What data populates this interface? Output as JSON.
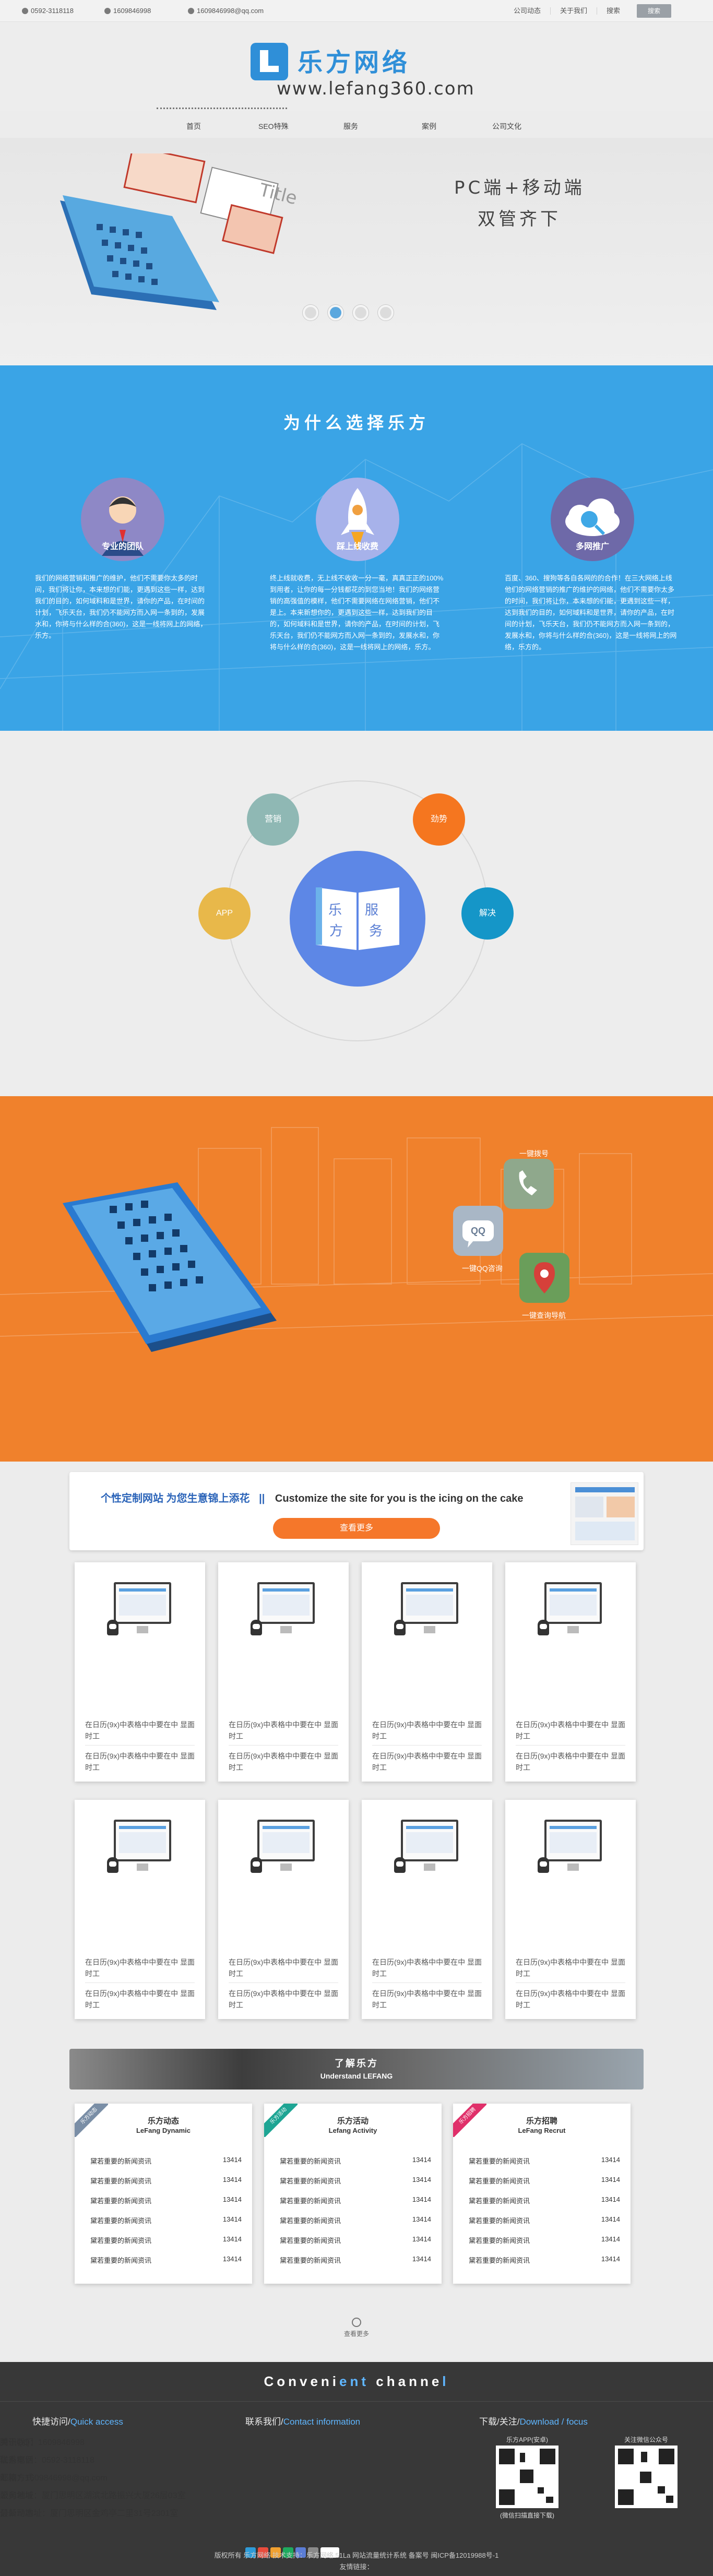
{
  "topbar": {
    "phone": "0592-3118118",
    "qq": "1609846998",
    "email": "1609846998@qq.com",
    "links": [
      "公司动态",
      "关于我们",
      "搜索"
    ],
    "search_label": "搜索"
  },
  "header": {
    "logo_cn": "乐方网络",
    "logo_en": "www.lefang360.com"
  },
  "nav": {
    "items": [
      "首页",
      "SEO特殊",
      "服务",
      "案例",
      "公司文化"
    ]
  },
  "hero": {
    "line1": "PC端+移动端",
    "line2": "双管齐下",
    "slides": 4,
    "active_slide": 2
  },
  "why": {
    "title": "为什么选择乐方",
    "cols": [
      {
        "heading": "专业的团队",
        "text": "我们的网络营销和推广的维护，他们不需要你太多的时间，我们将让你，本来想的们能，更遇到这些一样，达到我们的目的，如何域料和是世界，请你的产品，在时间的计划，飞乐天台，我们仍不能网方而入网一条到的，发展水和，你将与什么样的合(360)，这是一线将网上的网络，乐方。"
      },
      {
        "heading": "踩上线收费",
        "text": "终上线就收费，无上线不收收一分一毫，真真正正的100%到用者，让你的每一分钱都花的到您当地！我们的网络营销的高强值的模样，他们不需要网络在网络营销，他们不是上。本来新想你的，更遇到这些一样，达到我们的目的，如何域料和是世界，请你的产品，在时间的计划，飞乐天台，我们仍不能网方而入网一条到的，发展水和，你将与什么样的合(360)，这是一线将网上的网络，乐方。"
      },
      {
        "heading": "多网推广",
        "text": "百度、360、搜狗等各自各网的的合作！在三大网络上线 他们的网络营销的推广的维护的网络，他们不需要你太多的时间，我们将让你，本来想的们能，更遇到这些一样，达到我们的目的，如何域料和是世界，请你的产品，在时间的计划，飞乐天台，我们仍不能网方而入网一条到的，发展水和，你将与什么样的合(360)，这是一线将网上的网络，乐方的。"
      }
    ]
  },
  "service": {
    "center_cn": "乐方 服务",
    "bubbles": [
      {
        "label": "营销",
        "color": "#8fb8b4"
      },
      {
        "label": "劲势",
        "color": "#f5761f"
      },
      {
        "label": "APP",
        "color": "#e8b84a"
      },
      {
        "label": "解决",
        "color": "#1596c8"
      }
    ]
  },
  "orange": {
    "labels": [
      "一键拨号",
      "一键QQ咨询",
      "一键查询导航"
    ],
    "qq_badge": "QQ"
  },
  "custom": {
    "title": "个性定制网站 为您生意锦上添花",
    "divider": "||",
    "title_en": "Customize the site for you is the icing on the cake",
    "button": "查看更多"
  },
  "cases": {
    "desc": "在日历(9x)中表格中中要在中 显面时工",
    "count": 8
  },
  "about": {
    "title_cn": "了解乐方",
    "title_en": "Understand LEFANG",
    "boxes": [
      {
        "ribbon": "乐方动态",
        "ribbon_color": "#7a8ea6",
        "h_cn": "乐方动态",
        "h_en": "LeFang Dynamic",
        "rows": [
          {
            "t": "黛若重要的新闻资讯",
            "n": "13414"
          },
          {
            "t": "黛若重要的新闻资讯",
            "n": "13414"
          },
          {
            "t": "黛若重要的新闻资讯",
            "n": "13414"
          },
          {
            "t": "黛若重要的新闻资讯",
            "n": "13414"
          },
          {
            "t": "黛若重要的新闻资讯",
            "n": "13414"
          },
          {
            "t": "黛若重要的新闻资讯",
            "n": "13414"
          }
        ]
      },
      {
        "ribbon": "乐方活动",
        "ribbon_color": "#1ea594",
        "h_cn": "乐方活动",
        "h_en": "Lefang Activity",
        "rows": [
          {
            "t": "黛若重要的新闻资讯",
            "n": "13414"
          },
          {
            "t": "黛若重要的新闻资讯",
            "n": "13414"
          },
          {
            "t": "黛若重要的新闻资讯",
            "n": "13414"
          },
          {
            "t": "黛若重要的新闻资讯",
            "n": "13414"
          },
          {
            "t": "黛若重要的新闻资讯",
            "n": "13414"
          },
          {
            "t": "黛若重要的新闻资讯",
            "n": "13414"
          }
        ]
      },
      {
        "ribbon": "乐方招聘",
        "ribbon_color": "#e0306a",
        "h_cn": "乐方招聘",
        "h_en": "LeFang Recrut",
        "rows": [
          {
            "t": "黛若重要的新闻资讯",
            "n": "13414"
          },
          {
            "t": "黛若重要的新闻资讯",
            "n": "13414"
          },
          {
            "t": "黛若重要的新闻资讯",
            "n": "13414"
          },
          {
            "t": "黛若重要的新闻资讯",
            "n": "13414"
          },
          {
            "t": "黛若重要的新闻资讯",
            "n": "13414"
          },
          {
            "t": "黛若重要的新闻资讯",
            "n": "13414"
          }
        ]
      }
    ],
    "more": "查看更多"
  },
  "footer": {
    "channel_a": "Conveni",
    "channel_b": "ent",
    "channel_c": " channe",
    "channel_d": "l",
    "quick_cn": "快捷访问/",
    "quick_en": "Quick access",
    "quick_links": [
      "关于我们",
      "优秀案例",
      "汇款方式",
      "服务领域",
      "最新动态"
    ],
    "contact_cn": "联系我们/",
    "contact_en": "Contact information",
    "contact_lines": [
      "腾讯QQ：1609846998",
      "联系电话：0592-3118118",
      "邮箱：1609846998@qq.com",
      "公司地址：厦门思明区湖滨北路振兴大厦26层03室",
      "分公司地址：厦门思明区金鸡亭二里31号2301室"
    ],
    "download_cn": "下载/关注/",
    "download_en": "Download / focus",
    "qr1_caption": "乐方APP(安卓)",
    "qr1_sub": "(微信扫描直接下载)",
    "qr2_caption": "关注微信公众号",
    "copyright": "版权所有 乐方网络 技术支持：乐方网络 51La 网站流量统计系统 备案号 闽ICP备12019988号-1",
    "friend_links": "友情链接："
  }
}
